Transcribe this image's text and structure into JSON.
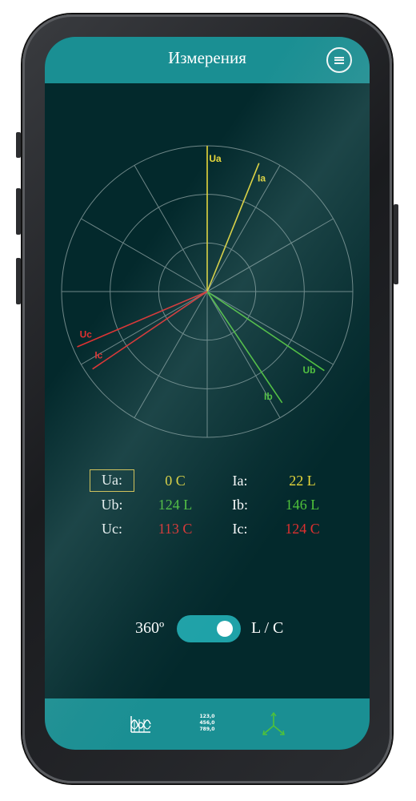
{
  "header": {
    "title": "Измерения",
    "menu_icon": "menu-icon"
  },
  "diagram": {
    "vectors": [
      {
        "label": "Ua",
        "angle_deg": 0,
        "magnitude": 1.0,
        "color": "#e8d83a"
      },
      {
        "label": "Ia",
        "angle_deg": 22,
        "magnitude": 0.95,
        "color": "#e8d83a"
      },
      {
        "label": "Ub",
        "angle_deg": 124,
        "magnitude": 0.97,
        "color": "#4fc23a"
      },
      {
        "label": "Ib",
        "angle_deg": 146,
        "magnitude": 0.92,
        "color": "#4fc23a"
      },
      {
        "label": "Uc",
        "angle_deg": 247,
        "magnitude": 0.97,
        "color": "#e03030"
      },
      {
        "label": "Ic",
        "angle_deg": 236,
        "magnitude": 0.95,
        "color": "#e03030"
      }
    ]
  },
  "readings": {
    "ua": {
      "label": "Ua:",
      "value": "0 C"
    },
    "ia": {
      "label": "Ia:",
      "value": "22 L"
    },
    "ub": {
      "label": "Ub:",
      "value": "124 L"
    },
    "ib": {
      "label": "Ib:",
      "value": "146 L"
    },
    "uc": {
      "label": "Uc:",
      "value": "113 C"
    },
    "ic": {
      "label": "Ic:",
      "value": "124 C"
    }
  },
  "toggle": {
    "left_label": "360º",
    "right_label": "L / C",
    "on": true
  },
  "bottom_nav": {
    "items": [
      {
        "name": "waveform",
        "icon": "waveform-icon"
      },
      {
        "name": "numbers",
        "icon": "numeric-values-icon",
        "lines": [
          "123,0",
          "456,0",
          "789,0"
        ]
      },
      {
        "name": "vectors",
        "icon": "vector-diagram-icon"
      }
    ]
  },
  "colors": {
    "accent": "#1a8f93",
    "background": "#03292c",
    "phase_a": "#e8d83a",
    "phase_b": "#4fc23a",
    "phase_c": "#e03030"
  }
}
